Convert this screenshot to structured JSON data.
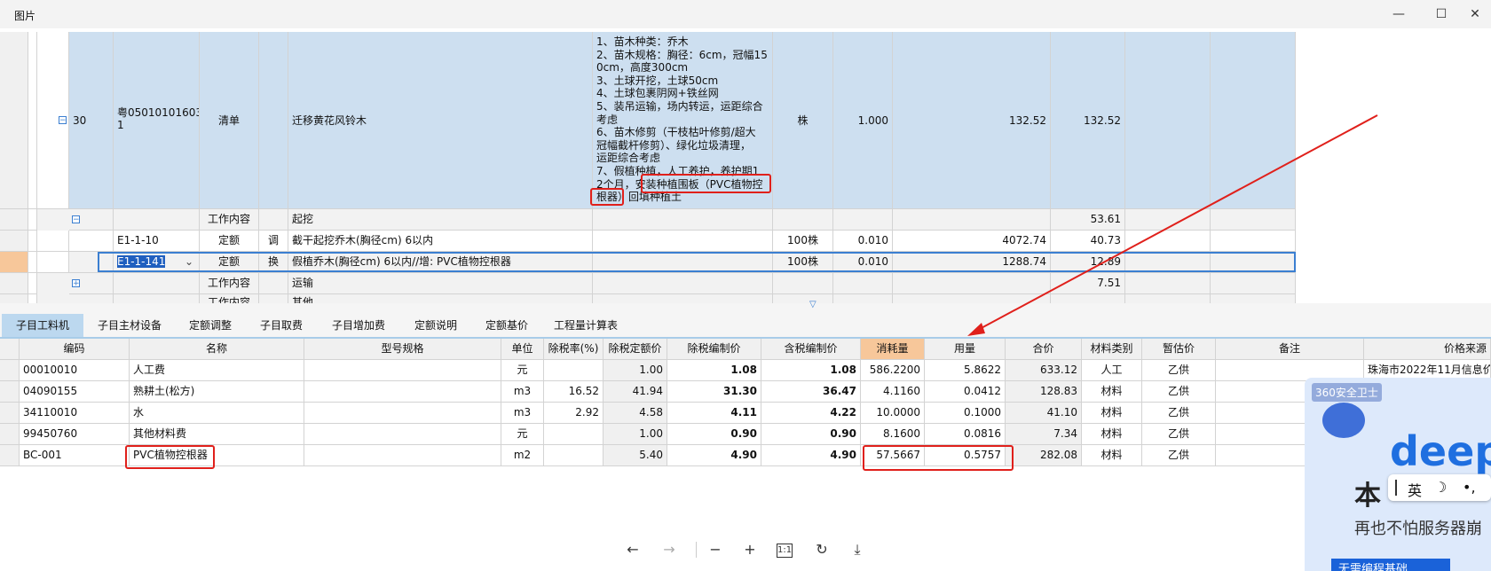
{
  "window": {
    "title": "图片",
    "minimize": "—",
    "maximize": "☐",
    "close": "✕"
  },
  "top_grid": {
    "main_row": {
      "index": "30",
      "code": "粤05010101603\n1",
      "type": "清单",
      "name": "迁移黄花风铃木",
      "desc": "1、苗木种类：乔木\n2、苗木规格：胸径：6cm，冠幅15\n0cm，高度300cm\n3、土球开挖，土球50cm\n4、土球包裹阴网+铁丝网\n5、装吊运输，场内转运，运距综合\n考虑\n6、苗木修剪（干枝枯叶修剪/超大\n冠幅截杆修剪）、绿化垃圾清理，\n运距综合考虑\n7、假植种植，人工养护，养护期1\n2个月，安装种植围板（PVC植物控\n根器）回填种植土",
      "unit": "株",
      "qty": "1.000",
      "price": "132.52",
      "total": "132.52"
    },
    "row_work1": {
      "type": "工作内容",
      "name": "起挖",
      "total": "53.61"
    },
    "row_e1": {
      "code": "E1-1-10",
      "type": "定额",
      "flag": "调",
      "name": "截干起挖乔木(胸径cm) 6以内",
      "unit": "100株",
      "qty": "0.010",
      "price": "4072.74",
      "total": "40.73"
    },
    "row_e2": {
      "code": "E1-1-141",
      "type": "定额",
      "flag": "换",
      "name": "假植乔木(胸径cm) 6以内//增: PVC植物控根器",
      "unit": "100株",
      "qty": "0.010",
      "price": "1288.74",
      "total": "12.89"
    },
    "row_work2": {
      "type": "工作内容",
      "name": "运输",
      "total": "7.51"
    },
    "row_work3": {
      "type": "工作内容",
      "name": "其他"
    }
  },
  "tabs": [
    "子目工料机",
    "子目主材设备",
    "定额调整",
    "子目取费",
    "子目增加费",
    "定额说明",
    "定额基价",
    "工程量计算表"
  ],
  "bottom_grid": {
    "headers": [
      "编码",
      "名称",
      "型号规格",
      "单位",
      "除税率(%)",
      "除税定额价",
      "除税编制价",
      "含税编制价",
      "消耗量",
      "用量",
      "合价",
      "材料类别",
      "暂估价",
      "备注",
      "价格来源"
    ],
    "rows": [
      [
        "00010010",
        "人工费",
        "",
        "元",
        "",
        "1.00",
        "1.08",
        "1.08",
        "586.2200",
        "5.8622",
        "633.12",
        "人工",
        "乙供",
        "",
        "珠海市2022年11月信息价"
      ],
      [
        "04090155",
        "熟耕土(松方)",
        "",
        "m3",
        "16.52",
        "41.94",
        "31.30",
        "36.47",
        "4.1160",
        "0.0412",
        "128.83",
        "材料",
        "乙供",
        "",
        ""
      ],
      [
        "34110010",
        "水",
        "",
        "m3",
        "2.92",
        "4.58",
        "4.11",
        "4.22",
        "10.0000",
        "0.1000",
        "41.10",
        "材料",
        "乙供",
        "",
        ""
      ],
      [
        "99450760",
        "其他材料费",
        "",
        "元",
        "",
        "1.00",
        "0.90",
        "0.90",
        "8.1600",
        "0.0816",
        "7.34",
        "材料",
        "乙供",
        "",
        ""
      ],
      [
        "BC-001",
        "PVC植物控根器",
        "",
        "m2",
        "",
        "5.40",
        "4.90",
        "4.90",
        "57.5667",
        "0.5757",
        "282.08",
        "材料",
        "乙供",
        "",
        ""
      ]
    ]
  },
  "toolbar": {
    "prev": "←",
    "next": "→",
    "zoom_out": "−",
    "zoom_in": "+",
    "actual": "1:1",
    "rotate": "↻",
    "download": "⤓"
  },
  "ad": {
    "brand": "360安全卫士",
    "headline": "deep",
    "line1": "本",
    "line2": "再也不怕服务器崩",
    "cta": "无需编程基础"
  },
  "ime": {
    "lang": "英",
    "moon": "☽",
    "dots": "•,"
  }
}
